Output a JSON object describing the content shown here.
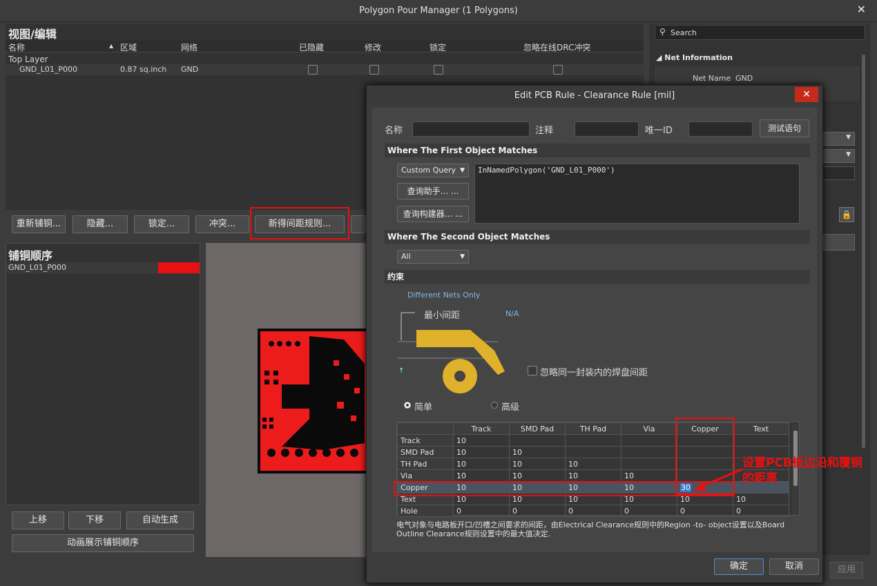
{
  "window": {
    "title": "Polygon Pour Manager (1 Polygons)",
    "close": "✕"
  },
  "view": {
    "title": "视图/编辑",
    "columns": [
      "名称",
      "区域",
      "网络",
      "已隐藏",
      "修改",
      "锁定",
      "忽略在线DRC冲突"
    ],
    "group": "Top Layer",
    "row": {
      "name": "GND_L01_P000",
      "area": "0.87 sq.inch",
      "net": "GND"
    }
  },
  "toolbar": {
    "repour": "重新铺铜...",
    "hide": "隐藏...",
    "lock": "锁定...",
    "conflict": "冲突...",
    "new_rule": "新得间距规则..."
  },
  "order": {
    "title": "铺铜顺序",
    "item": "GND_L01_P000",
    "up": "上移",
    "down": "下移",
    "auto": "自动生成",
    "animate": "动画展示铺铜顺序"
  },
  "right": {
    "search_placeholder": "Search",
    "net_info": "Net Information",
    "net_name_label": "Net Name",
    "net_name": "GND",
    "apply": "应用"
  },
  "dialog": {
    "title": "Edit PCB Rule - Clearance Rule [mil]",
    "close": "✕",
    "name_label": "名称",
    "comment_label": "注释",
    "uid_label": "唯一ID",
    "test_btn": "测试语句",
    "first_match": "Where The First Object Matches",
    "custom_query": "Custom Query",
    "query_helper": "查询助手... ...",
    "query_builder": "查询构建器... ...",
    "query_text": "InNamedPolygon('GND_L01_P000')",
    "second_match": "Where The Second Object Matches",
    "all": "All",
    "constraints": "约束",
    "diff_nets": "Different Nets Only",
    "min_clear": "最小间距",
    "na": "N/A",
    "ignore_pads": "忽略同一封装内的焊盘间距",
    "simple": "简单",
    "advanced": "高级",
    "matrix": {
      "cols": [
        "Track",
        "SMD Pad",
        "TH Pad",
        "Via",
        "Copper",
        "Text"
      ],
      "rows": [
        {
          "name": "Track",
          "vals": [
            "10",
            "",
            "",
            "",
            "",
            ""
          ]
        },
        {
          "name": "SMD Pad",
          "vals": [
            "10",
            "10",
            "",
            "",
            "",
            ""
          ]
        },
        {
          "name": "TH Pad",
          "vals": [
            "10",
            "10",
            "10",
            "",
            "",
            ""
          ]
        },
        {
          "name": "Via",
          "vals": [
            "10",
            "10",
            "10",
            "10",
            "",
            ""
          ]
        },
        {
          "name": "Copper",
          "vals": [
            "10",
            "10",
            "10",
            "10",
            "30",
            ""
          ]
        },
        {
          "name": "Text",
          "vals": [
            "10",
            "10",
            "10",
            "10",
            "10",
            "10"
          ]
        },
        {
          "name": "Hole",
          "vals": [
            "0",
            "0",
            "0",
            "0",
            "0",
            "0"
          ]
        }
      ]
    },
    "note": "电气对象与电路板开口/凹槽之间要求的间距，由Electrical Clearance规则中的Region -to- object设置以及Board Outline Clearance规则设置中的最大值决定.",
    "ok": "确定",
    "cancel": "取消"
  },
  "annotation": {
    "text": "设置PCB板边沿和覆铜的距离"
  },
  "colors": {
    "highlight": "#e81010",
    "gold": "#e0b12a"
  }
}
